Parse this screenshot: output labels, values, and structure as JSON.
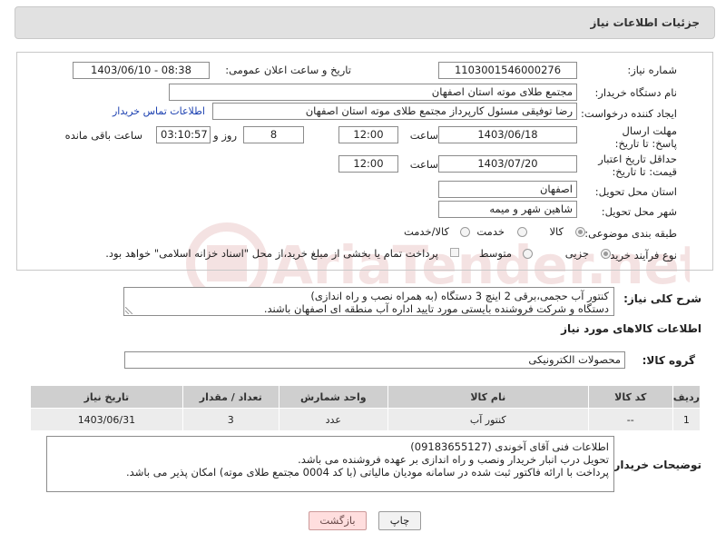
{
  "header": {
    "title": "جزئیات اطلاعات نیاز"
  },
  "fields": {
    "need_number_label": "شماره نیاز:",
    "need_number": "1103001546000276",
    "announce_label": "تاریخ و ساعت اعلان عمومی:",
    "announce_value": "1403/06/10 - 08:38",
    "buyer_org_label": "نام دستگاه خریدار:",
    "buyer_org": "مجتمع طلای موته استان اصفهان",
    "creator_label": "ایجاد کننده درخواست:",
    "creator": "رضا توفیقی مسئول کارپرداز مجتمع طلای موته استان اصفهان",
    "buyer_contact_link": "اطلاعات تماس خریدار",
    "reply_deadline_label": "مهلت ارسال پاسخ: تا تاریخ:",
    "reply_date": "1403/06/18",
    "hour_label": "ساعت",
    "reply_time": "12:00",
    "days_value": "8",
    "days_and_label": "روز و",
    "remaining_time": "03:10:57",
    "remaining_label": "ساعت باقی مانده",
    "min_price_label": "حداقل تاریخ اعتبار قیمت: تا تاریخ:",
    "price_date": "1403/07/20",
    "price_time": "12:00",
    "province_label": "استان محل تحویل:",
    "province": "اصفهان",
    "city_label": "شهر محل تحویل:",
    "city": "شاهین شهر و میمه",
    "category_label": "طبقه بندی موضوعی:",
    "category_options": [
      "کالا",
      "خدمت",
      "کالا/خدمت"
    ],
    "process_label": "نوع فرآیند خرید :",
    "process_options": [
      "جزیی",
      "متوسط"
    ],
    "payment_note": "پرداخت تمام یا بخشی از مبلغ خرید،از محل \"اسناد خزانه اسلامی\" خواهد بود."
  },
  "description": {
    "label": "شرح کلی نیاز:",
    "lines": [
      "کنتور آب حجمی،برقی 2 اینچ 3 دستگاه (به همراه نصب و راه اندازی)",
      "دستگاه و شرکت فروشنده بایستی مورد تایید اداره آب منطقه ای اصفهان باشند."
    ]
  },
  "goods_info_title": "اطلاعات کالاهای مورد نیاز",
  "goods_group": {
    "label": "گروه کالا:",
    "value": "محصولات الکترونیکی"
  },
  "table": {
    "headers": [
      "ردیف",
      "کد کالا",
      "نام کالا",
      "واحد شمارش",
      "تعداد / مقدار",
      "تاریخ نیاز"
    ],
    "rows": [
      [
        "1",
        "--",
        "کنتور آب",
        "عدد",
        "3",
        "1403/06/31"
      ]
    ]
  },
  "buyer_notes": {
    "label": "توضیحات خریدار:",
    "lines": [
      "اطلاعات فنی آقای آخوندی (09183655127)",
      "تحویل درب انبار خریدار ونصب و راه اندازی بر عهده فروشنده می باشد.",
      "پرداخت با ارائه فاکتور ثبت شده در سامانه مودیان مالیاتی (با کد 0004 مجتمع طلای موته) امکان پذیر می باشد."
    ]
  },
  "buttons": {
    "print": "چاپ",
    "back": "بازگشت"
  },
  "watermark": {
    "text": "AriaTender.net",
    "color": "#b22a2a"
  }
}
